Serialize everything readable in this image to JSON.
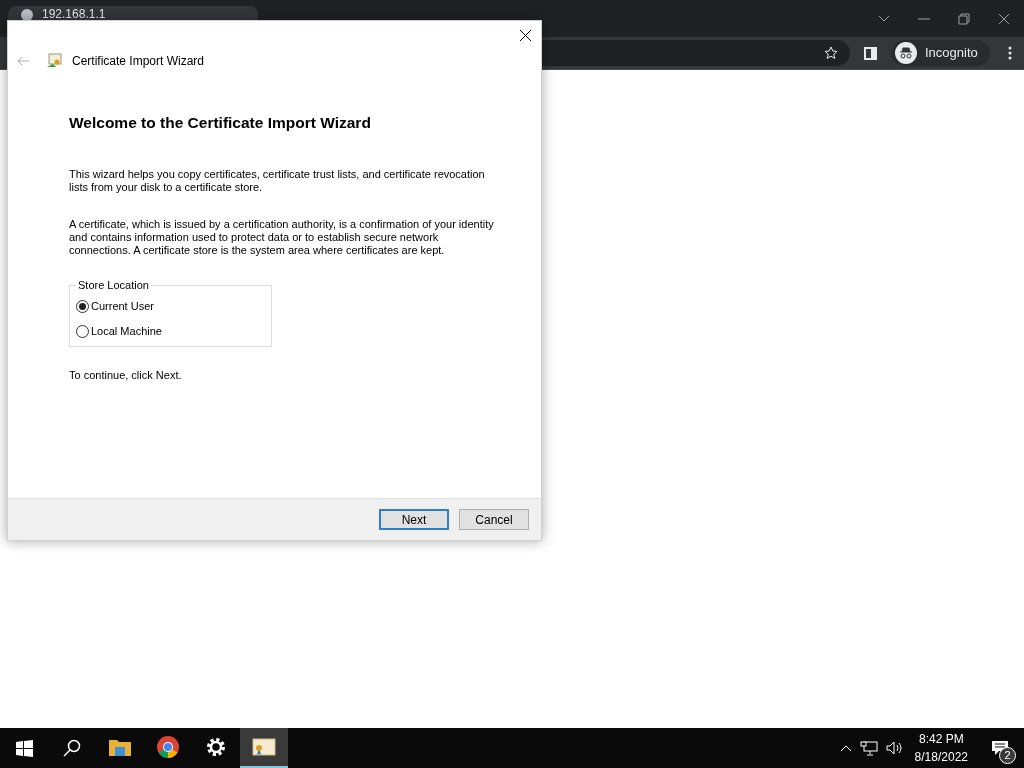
{
  "browser": {
    "tab": {
      "title": "192.168.1.1"
    },
    "profile": "Incognito"
  },
  "dialog": {
    "title": "Certificate Import Wizard",
    "heading": "Welcome to the Certificate Import Wizard",
    "paragraphs": [
      "This wizard helps you copy certificates, certificate trust lists, and certificate revocation lists from your disk to a certificate store.",
      "A certificate, which is issued by a certification authority, is a confirmation of your identity and contains information used to protect data or to establish secure network connections. A certificate store is the system area where certificates are kept."
    ],
    "store_location": {
      "label": "Store Location",
      "options": [
        {
          "label": "Current User",
          "selected": true
        },
        {
          "label": "Local Machine",
          "selected": false
        }
      ]
    },
    "hint": "To continue, click Next.",
    "buttons": [
      {
        "label": "Next",
        "default": true
      },
      {
        "label": "Cancel",
        "default": false
      }
    ]
  },
  "taskbar": {
    "apps": [
      {
        "kind": "folder",
        "active": false
      },
      {
        "kind": "chrome",
        "active": false
      },
      {
        "kind": "settings",
        "active": false
      },
      {
        "kind": "certificate",
        "active": true
      }
    ],
    "time": "8:42 PM",
    "date": "8/18/2022",
    "notifications": "2"
  }
}
